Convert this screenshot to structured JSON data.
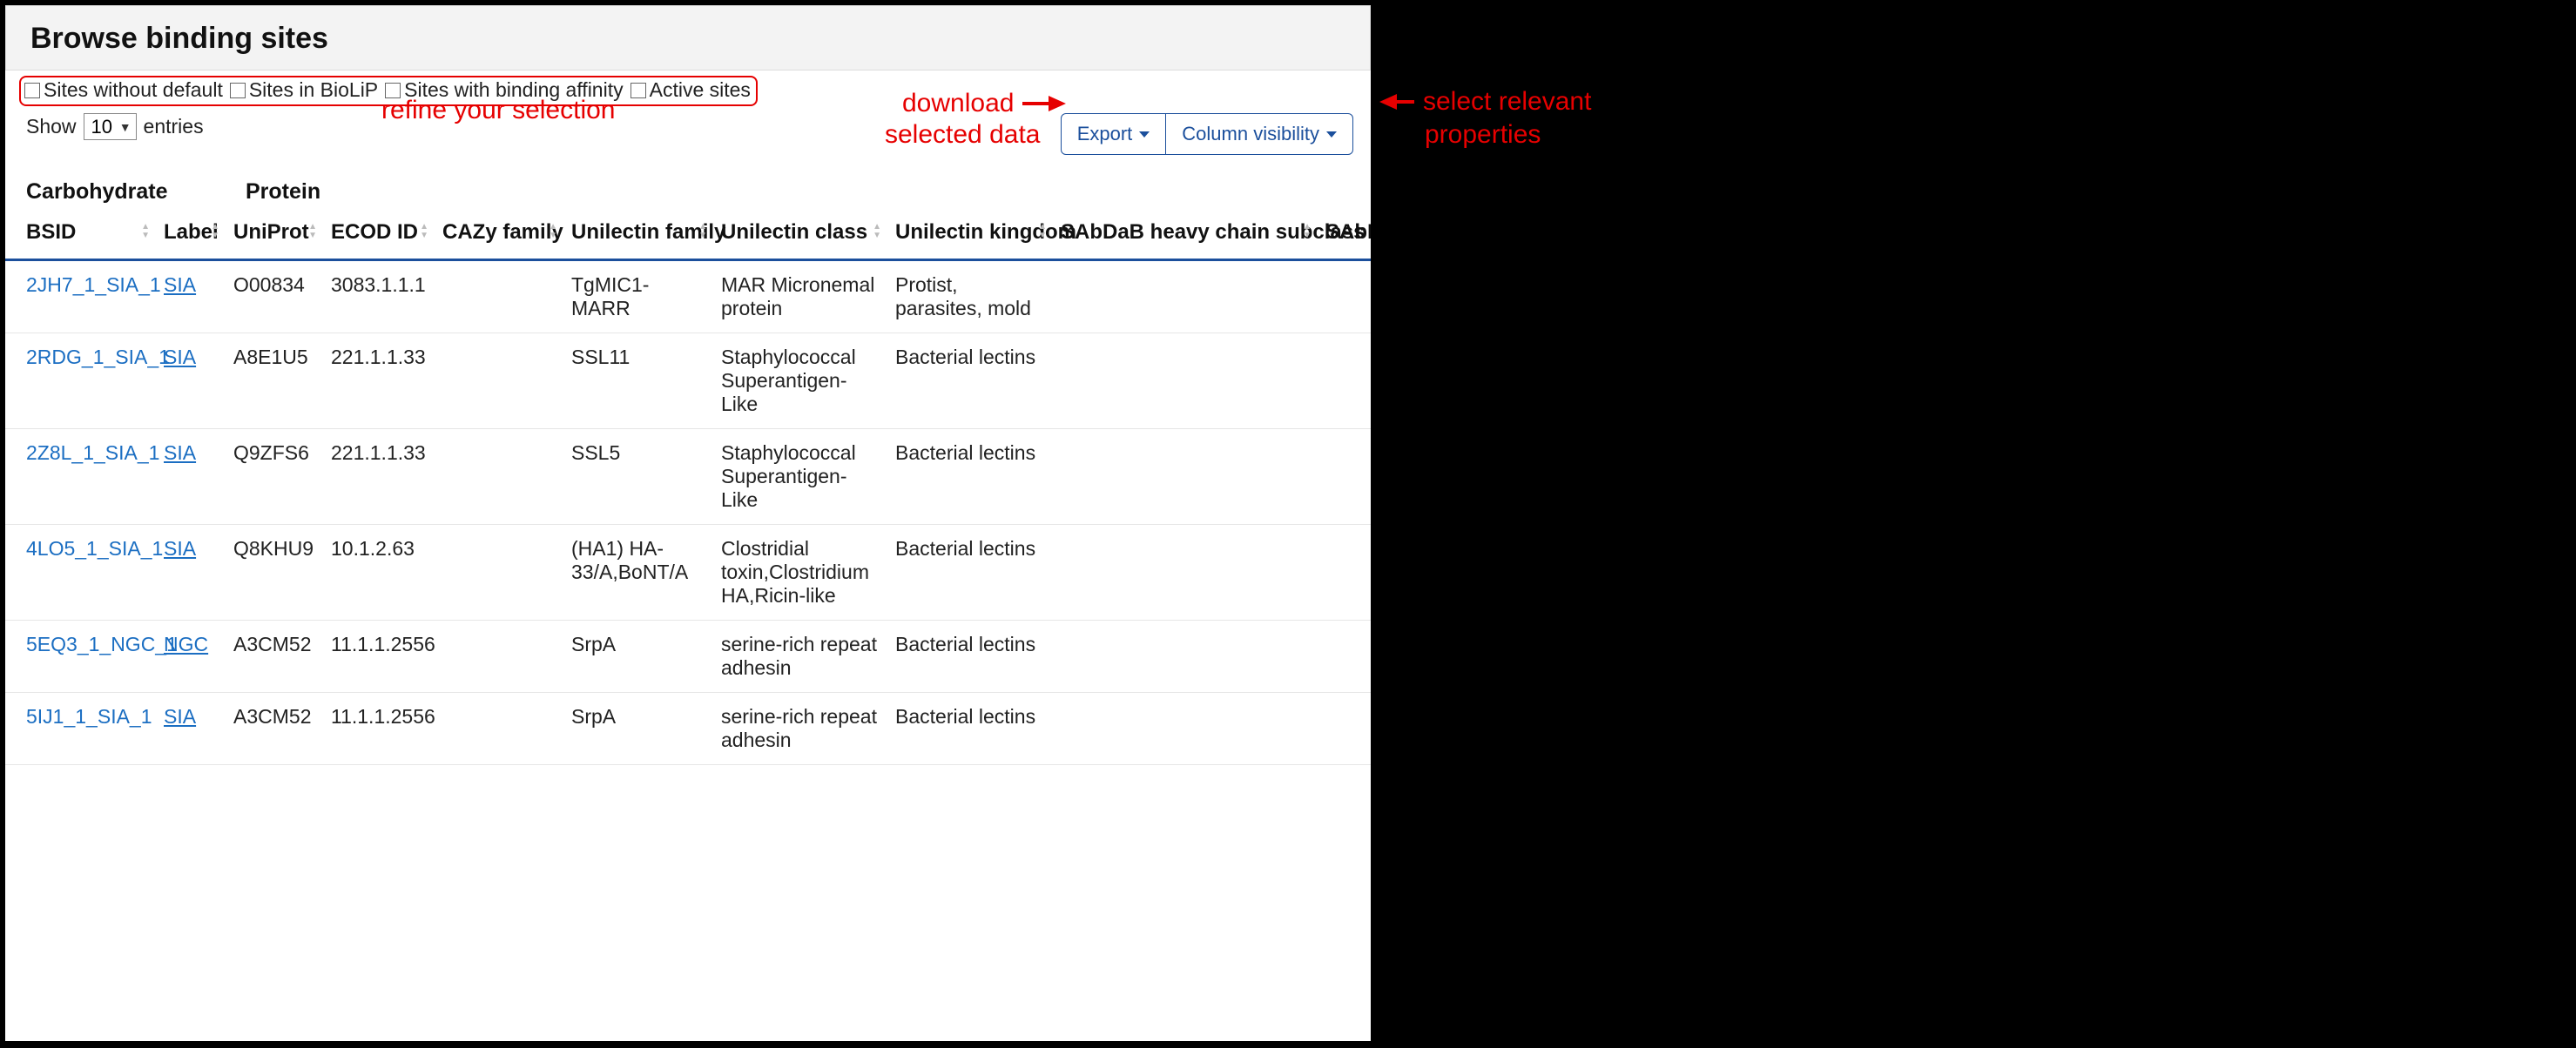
{
  "header": {
    "title": "Browse binding sites"
  },
  "filters": {
    "opt1": "Sites without default",
    "opt2": "Sites in BioLiP",
    "opt3": "Sites with binding affinity",
    "opt4": "Active sites"
  },
  "length": {
    "show": "Show",
    "value": "10",
    "entries": "entries"
  },
  "buttons": {
    "export": "Export",
    "colvis": "Column visibility"
  },
  "group_heads": {
    "carb": "Carbohydrate",
    "prot": "Protein"
  },
  "columns": {
    "bsid": "BSID",
    "label": "Label",
    "uniprot": "UniProt",
    "ecod": "ECOD ID",
    "cazy": "CAZy family",
    "unifam": "Unilectin family",
    "unicls": "Unilectin class",
    "uniking": "Unilectin kingdom",
    "sabdab": "SAbDaB heavy chain subclass",
    "sabd2": "SAbD"
  },
  "rows": [
    {
      "bsid": "2JH7_1_SIA_1",
      "label": "SIA",
      "uniprot": "O00834",
      "ecod": "3083.1.1.1",
      "cazy": "",
      "unifam": "TgMIC1-MARR",
      "unicls": "MAR Micronemal protein",
      "uniking": "Protist, parasites, mold",
      "sabdab": "",
      "sabd2": ""
    },
    {
      "bsid": "2RDG_1_SIA_1",
      "label": "SIA",
      "uniprot": "A8E1U5",
      "ecod": "221.1.1.33",
      "cazy": "",
      "unifam": "SSL11",
      "unicls": "Staphylococcal Superantigen-Like",
      "uniking": "Bacterial lectins",
      "sabdab": "",
      "sabd2": ""
    },
    {
      "bsid": "2Z8L_1_SIA_1",
      "label": "SIA",
      "uniprot": "Q9ZFS6",
      "ecod": "221.1.1.33",
      "cazy": "",
      "unifam": "SSL5",
      "unicls": "Staphylococcal Superantigen-Like",
      "uniking": "Bacterial lectins",
      "sabdab": "",
      "sabd2": ""
    },
    {
      "bsid": "4LO5_1_SIA_1",
      "label": "SIA",
      "uniprot": "Q8KHU9",
      "ecod": "10.1.2.63",
      "cazy": "",
      "unifam": "(HA1) HA-33/A,BoNT/A",
      "unicls": "Clostridial toxin,Clostridium HA,Ricin-like",
      "uniking": "Bacterial lectins",
      "sabdab": "",
      "sabd2": ""
    },
    {
      "bsid": "5EQ3_1_NGC_1",
      "label": "NGC",
      "uniprot": "A3CM52",
      "ecod": "11.1.1.2556",
      "cazy": "",
      "unifam": "SrpA",
      "unicls": "serine-rich repeat adhesin",
      "uniking": "Bacterial lectins",
      "sabdab": "",
      "sabd2": ""
    },
    {
      "bsid": "5IJ1_1_SIA_1",
      "label": "SIA",
      "uniprot": "A3CM52",
      "ecod": "11.1.1.2556",
      "cazy": "",
      "unifam": "SrpA",
      "unicls": "serine-rich repeat adhesin",
      "uniking": "Bacterial lectins",
      "sabdab": "",
      "sabd2": ""
    }
  ],
  "annotations": {
    "refine": "refine your selection",
    "download1": "download",
    "download2": "selected data",
    "select1": "select relevant",
    "select2": "properties"
  }
}
